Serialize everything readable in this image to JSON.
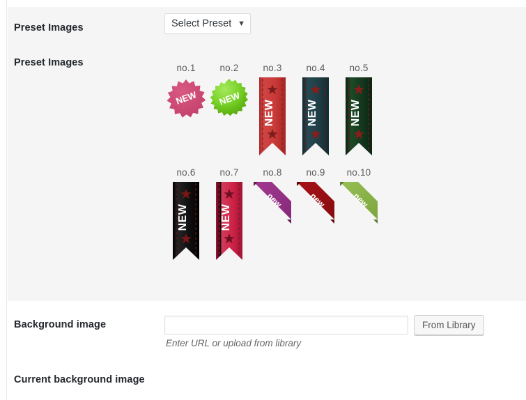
{
  "form": {
    "rows": [
      {
        "label": "Preset Images"
      },
      {
        "label": "Preset Images"
      },
      {
        "label": "Background image"
      },
      {
        "label": "Current background image"
      }
    ]
  },
  "preset_select": {
    "label": "Preset Images",
    "selected": "Select Preset",
    "arrow_icon": "chevron-down-icon",
    "options": [
      "Select Preset"
    ]
  },
  "preset_images": {
    "label": "Preset Images",
    "items": [
      {
        "caption": "no.1",
        "style": "starburst",
        "text": "NEW",
        "color": "#cf4571",
        "color2": "#b93a63",
        "text_color": "#ffffff"
      },
      {
        "caption": "no.2",
        "style": "starburst",
        "text": "NEW",
        "color": "#7ad32a",
        "color2": "#5fb312",
        "text_color": "#ffffff"
      },
      {
        "caption": "no.3",
        "style": "ribbon",
        "text": "NEW",
        "color": "#c93a38",
        "color2": "#ad2b2a",
        "text_color": "#ffffff",
        "star_color": "#7a1d1c",
        "stitch_color": "#8e2422"
      },
      {
        "caption": "no.4",
        "style": "ribbon",
        "text": "NEW",
        "color": "#1e3d44",
        "color2": "#152b31",
        "text_color": "#ffffff",
        "star_color": "#8a1c1c",
        "stitch_color": "#6d1a1a"
      },
      {
        "caption": "no.5",
        "style": "ribbon",
        "text": "NEW",
        "color": "#14361d",
        "color2": "#0d2614",
        "text_color": "#ffffff",
        "star_color": "#8a1c1c",
        "stitch_color": "#6d1a1a"
      },
      {
        "caption": "no.6",
        "style": "ribbon",
        "text": "NEW",
        "color": "#101010",
        "color2": "#000000",
        "text_color": "#ffffff",
        "star_color": "#7a1616",
        "stitch_color": "#5e1212"
      },
      {
        "caption": "no.7",
        "style": "ribbon",
        "text": "NEW",
        "color": "#cc2246",
        "color2": "#aa1537",
        "text_color": "#ffffff",
        "star_color": "#6e0f22",
        "stitch_color": "#8c1730"
      },
      {
        "caption": "no.8",
        "style": "corner",
        "text": "new",
        "color": "#973084",
        "color2": "#7d2370",
        "text_color": "#ffffff",
        "shadow_color": "#5f1a55"
      },
      {
        "caption": "no.9",
        "style": "corner",
        "text": "new",
        "color": "#9b0f13",
        "color2": "#7e0b0f",
        "text_color": "#ffffff",
        "shadow_color": "#5c0709"
      },
      {
        "caption": "no.10",
        "style": "corner",
        "text": "new",
        "color": "#8cb64a",
        "color2": "#779c3c",
        "text_color": "#ffffff",
        "shadow_color": "#5b7a2c"
      }
    ]
  },
  "background_image": {
    "label": "Background image",
    "value": "",
    "placeholder": "",
    "button_label": "From Library",
    "helper": "Enter URL or upload from library"
  },
  "current_background_image": {
    "label": "Current background image"
  },
  "colors": {
    "row_alt_bg": "#f5f5f5",
    "row_bg": "#ffffff",
    "label_text": "#23282d",
    "caption_text": "#5a5a5a",
    "helper_text": "#666666"
  }
}
